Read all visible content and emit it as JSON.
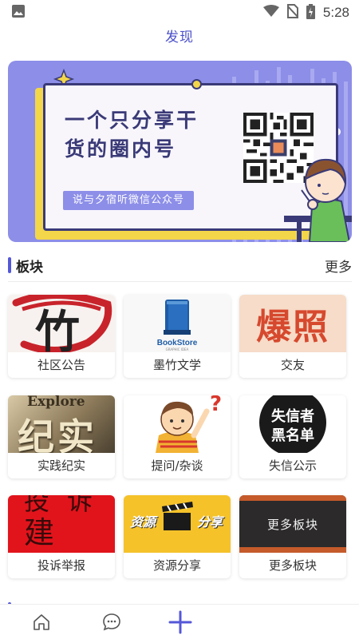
{
  "status_bar": {
    "time": "5:28",
    "icons": [
      "image-icon",
      "wifi-icon",
      "no-sim-icon",
      "battery-charging-icon"
    ]
  },
  "header": {
    "title": "发现"
  },
  "banner": {
    "headline_line1": "一个只分享干",
    "headline_line2": "货的圈内号",
    "subtitle": "说与夕宿听微信公众号",
    "dot_count": 5,
    "active_dot": 4,
    "colors": {
      "background": "#8c8ee8",
      "card_border": "#3a3a78",
      "accent_yellow": "#f3d64a"
    }
  },
  "section": {
    "title": "板块",
    "more_label": "更多"
  },
  "boards": [
    {
      "label": "社区公告",
      "image_text": "竹"
    },
    {
      "label": "墨竹文学",
      "image_text": "BookStore",
      "image_subtext": "GRAPHIC IDEA"
    },
    {
      "label": "交友",
      "image_text": "爆照"
    },
    {
      "label": "实践纪实",
      "image_text": "纪实",
      "image_subtext": "Explore"
    },
    {
      "label": "提问/杂谈",
      "image_text": "?"
    },
    {
      "label": "失信公示",
      "image_text": "失信者",
      "image_subtext": "黑名单"
    },
    {
      "label": "投诉举报",
      "image_text": "建议",
      "image_subtext": "投诉"
    },
    {
      "label": "资源分享",
      "image_text": "资源",
      "image_subtext": "分享"
    },
    {
      "label": "更多板块",
      "image_text": "更多板块"
    }
  ],
  "tabbar": {
    "items": [
      "home-icon",
      "chat-icon",
      "add-icon"
    ]
  },
  "colors": {
    "accent": "#5457d8"
  }
}
